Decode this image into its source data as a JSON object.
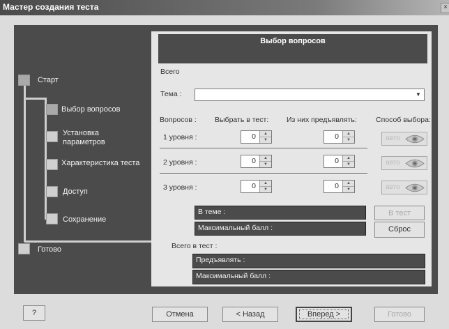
{
  "window": {
    "title": "Мастер создания теста",
    "close_glyph": "×"
  },
  "steps": [
    {
      "label": "Старт"
    },
    {
      "label": "Выбор вопросов"
    },
    {
      "label": "Установка параметров"
    },
    {
      "label": "Характеристика теста"
    },
    {
      "label": "Доступ"
    },
    {
      "label": "Сохранение"
    },
    {
      "label": "Готово"
    }
  ],
  "panel": {
    "header": "Выбор вопросов",
    "total_label": "Всего",
    "topic_label": "Тема :",
    "topic_value": "",
    "columns": {
      "questions": "Вопросов :",
      "choose": "Выбрать в тест:",
      "present": "Из них предъявлять:",
      "method": "Способ выбора:"
    },
    "levels": [
      {
        "label": "1 уровня :",
        "choose": "0",
        "present": "0",
        "method": "авто"
      },
      {
        "label": "2 уровня :",
        "choose": "0",
        "present": "0",
        "method": "авто"
      },
      {
        "label": "3 уровня :",
        "choose": "0",
        "present": "0",
        "method": "авто"
      }
    ],
    "in_topic": "В теме :",
    "max_score": "Максимальный балл :",
    "to_test_button": "В тест",
    "reset_button": "Сброс",
    "total_in_test_label": "Всего в тест :",
    "present_bar": "Предъявлять :",
    "max_score_bar": "Максимальный балл :"
  },
  "footer": {
    "help": "?",
    "cancel": "Отмена",
    "back": "< Назад",
    "next": "Вперед >",
    "finish": "Готово"
  }
}
